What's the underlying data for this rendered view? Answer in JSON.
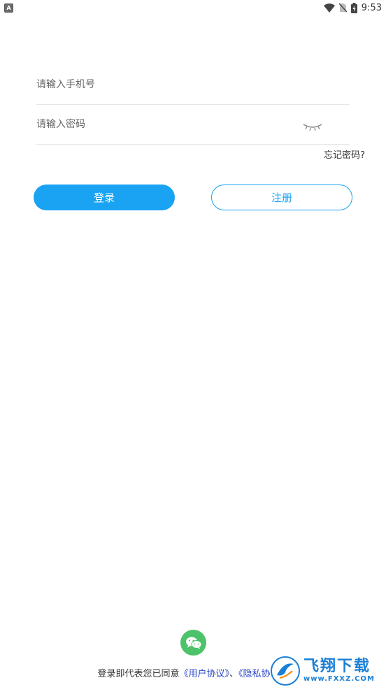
{
  "status_bar": {
    "time": "9:53",
    "app_badge": "A"
  },
  "login_form": {
    "phone_placeholder": "请输入手机号",
    "password_placeholder": "请输入密码",
    "forgot_password": "忘记密码?"
  },
  "buttons": {
    "login": "登录",
    "register": "注册"
  },
  "agreement": {
    "prefix": "登录即代表您已同意",
    "user_agreement": "《用户协议》",
    "separator": "、",
    "privacy_policy": "《隐私协议》"
  },
  "watermark": {
    "brand_cn": "飞翔下载",
    "url": "www.FXXZ.COM"
  },
  "colors": {
    "primary": "#1aa3f2",
    "wechat": "#4cc26a",
    "link": "#2a44c9"
  },
  "icons": [
    "wifi-icon",
    "no-sim-icon",
    "battery-icon",
    "eye-closed-icon",
    "wechat-icon"
  ]
}
